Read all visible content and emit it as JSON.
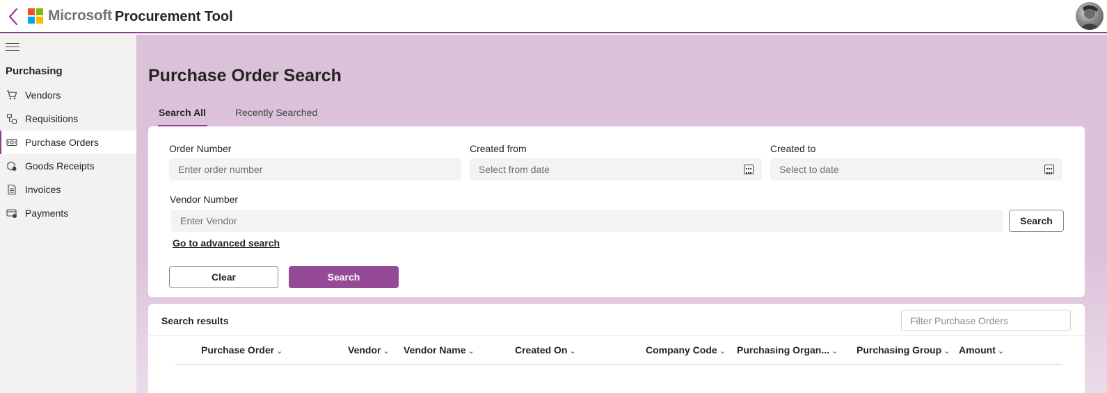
{
  "header": {
    "brand": "Microsoft",
    "app_title": "Procurement Tool",
    "colors": {
      "accent": "#8e3f8c",
      "ms_red": "#f25022",
      "ms_green": "#7fba00",
      "ms_blue": "#00a4ef",
      "ms_yellow": "#ffb900"
    }
  },
  "sidebar": {
    "section_title": "Purchasing",
    "items": [
      {
        "label": "Vendors",
        "icon": "cart-icon"
      },
      {
        "label": "Requisitions",
        "icon": "requisitions-icon"
      },
      {
        "label": "Purchase Orders",
        "icon": "purchase-orders-icon",
        "active": true
      },
      {
        "label": "Goods Receipts",
        "icon": "goods-receipts-icon"
      },
      {
        "label": "Invoices",
        "icon": "document-icon"
      },
      {
        "label": "Payments",
        "icon": "payments-icon"
      }
    ]
  },
  "main": {
    "page_title": "Purchase Order Search",
    "tabs": [
      {
        "label": "Search All",
        "active": true
      },
      {
        "label": "Recently Searched"
      }
    ],
    "form": {
      "order_number": {
        "label": "Order Number",
        "placeholder": "Enter order number"
      },
      "created_from": {
        "label": "Created from",
        "placeholder": "Select from date"
      },
      "created_to": {
        "label": "Created to",
        "placeholder": "Select to date"
      },
      "vendor_number": {
        "label": "Vendor Number",
        "placeholder": "Enter Vendor"
      },
      "vendor_search_button": "Search",
      "advanced_link": "Go to advanced search",
      "clear_button": "Clear",
      "search_button": "Search"
    },
    "results": {
      "title": "Search results",
      "filter_placeholder": "Filter Purchase Orders",
      "columns": [
        "Purchase Order",
        "Vendor",
        "Vendor Name",
        "Created On",
        "Company Code",
        "Purchasing Organ...",
        "Purchasing Group",
        "Amount"
      ]
    }
  }
}
